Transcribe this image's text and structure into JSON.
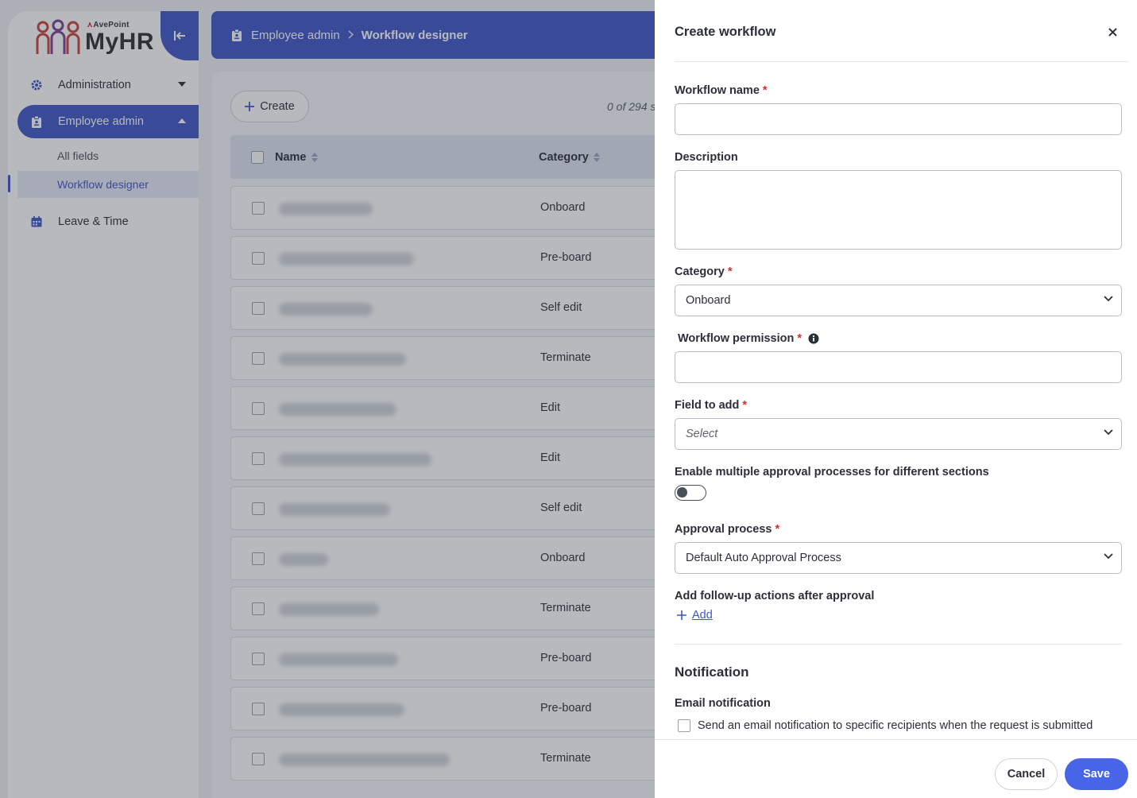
{
  "brand": {
    "company": "AvePoint",
    "product": "MyHR"
  },
  "sidebar": {
    "items": [
      {
        "label": "Administration",
        "icon": "gear-icon"
      },
      {
        "label": "Employee admin",
        "icon": "badge-icon"
      },
      {
        "label": "Leave & Time",
        "icon": "calendar-icon"
      }
    ],
    "sub_items": [
      {
        "label": "All fields"
      },
      {
        "label": "Workflow designer"
      }
    ]
  },
  "header": {
    "breadcrumb_parent": "Employee admin",
    "breadcrumb_current": "Workflow designer"
  },
  "main": {
    "create_label": "Create",
    "count_text": "0 of 294 s",
    "columns": [
      "Name",
      "Category"
    ],
    "rows": [
      {
        "category": "Onboard"
      },
      {
        "category": "Pre-board"
      },
      {
        "category": "Self edit"
      },
      {
        "category": "Terminate"
      },
      {
        "category": "Edit"
      },
      {
        "category": "Edit"
      },
      {
        "category": "Self edit"
      },
      {
        "category": "Onboard"
      },
      {
        "category": "Terminate"
      },
      {
        "category": "Pre-board"
      },
      {
        "category": "Pre-board"
      },
      {
        "category": "Terminate"
      }
    ]
  },
  "panel": {
    "title": "Create workflow",
    "workflow_name_label": "Workflow name",
    "workflow_name_value": "",
    "description_label": "Description",
    "description_value": "",
    "category_label": "Category",
    "category_value": "Onboard",
    "permission_label": "Workflow permission",
    "permission_value": "",
    "field_to_add_label": "Field to add",
    "field_to_add_placeholder": "Select",
    "multi_approval_label": "Enable multiple approval processes for different sections",
    "multi_approval_enabled": false,
    "approval_label": "Approval process",
    "approval_value": "Default Auto Approval Process",
    "followup_label": "Add follow-up actions after approval",
    "add_label": "Add",
    "notification_title": "Notification",
    "email_label": "Email notification",
    "email_checkbox_label": "Send an email notification to specific recipients when the request is submitted",
    "email_checked": false,
    "required_mark": "*",
    "cancel_label": "Cancel",
    "save_label": "Save"
  },
  "colors": {
    "accent": "#3e55c8",
    "save": "#4765e6",
    "required": "#d32f2f"
  }
}
